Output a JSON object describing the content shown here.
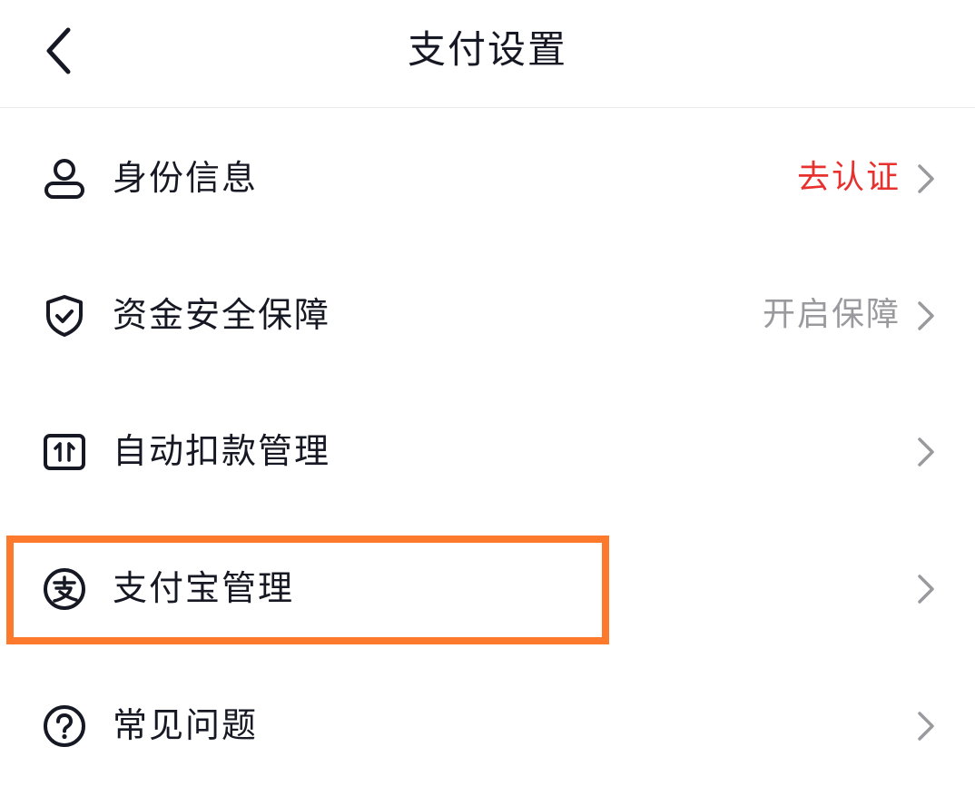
{
  "header": {
    "title": "支付设置",
    "back_icon": "chevron-left-icon"
  },
  "rows": [
    {
      "label": "身份信息",
      "value": "去认证",
      "value_color": "#e7312f",
      "icon": "person-icon"
    },
    {
      "label": "资金安全保障",
      "value": "开启保障",
      "value_color": "#9a9a9e",
      "icon": "shield-check-icon"
    },
    {
      "label": "自动扣款管理",
      "value": "",
      "value_color": "#9a9a9e",
      "icon": "auto-deduct-icon"
    },
    {
      "label": "支付宝管理",
      "value": "",
      "value_color": "#9a9a9e",
      "icon": "alipay-icon"
    },
    {
      "label": "常见问题",
      "value": "",
      "value_color": "#9a9a9e",
      "icon": "question-circle-icon"
    }
  ],
  "highlight": {
    "target": "支付宝管理",
    "color": "#fd7a2c"
  },
  "colors": {
    "text": "#161823",
    "chevron": "#9a9a9e",
    "icon": "#161823"
  }
}
